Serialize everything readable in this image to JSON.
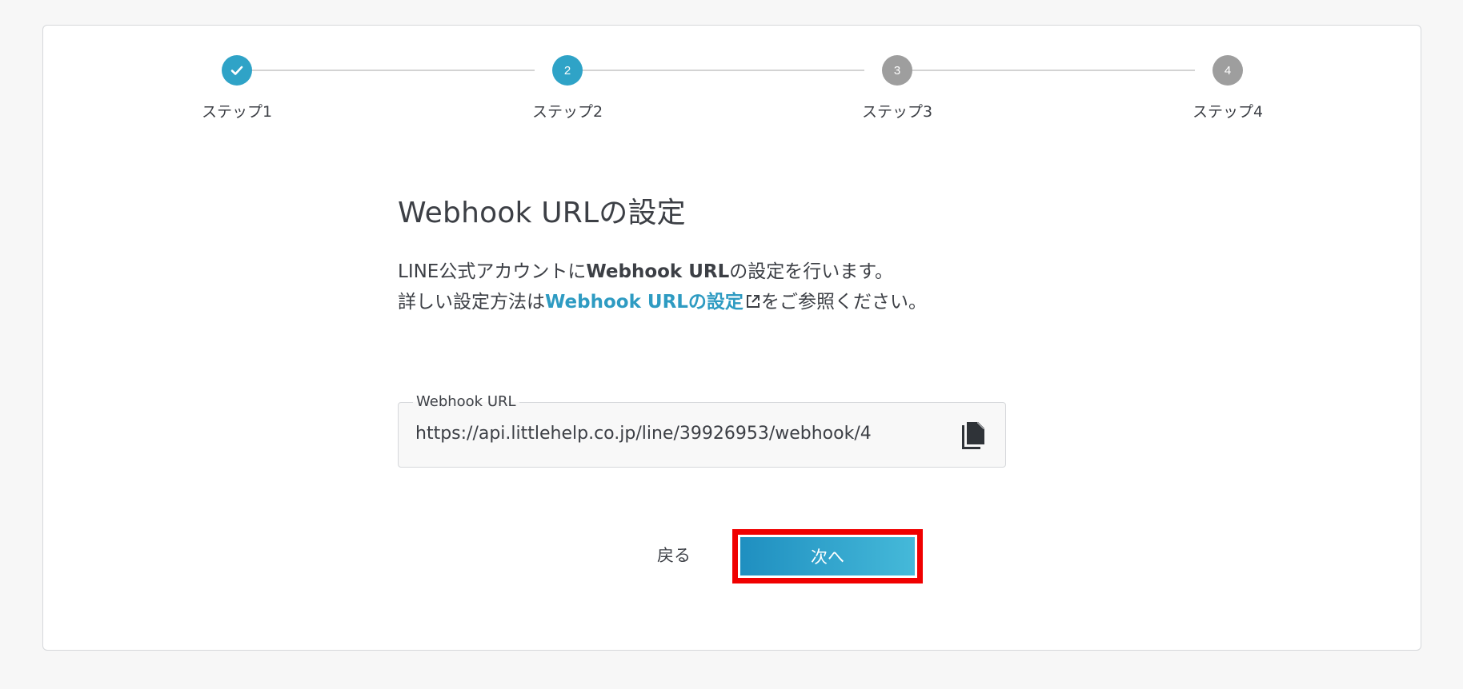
{
  "stepper": {
    "steps": [
      {
        "label": "ステップ1",
        "number": "",
        "state": "done"
      },
      {
        "label": "ステップ2",
        "number": "2",
        "state": "active"
      },
      {
        "label": "ステップ3",
        "number": "3",
        "state": "inactive"
      },
      {
        "label": "ステップ4",
        "number": "4",
        "state": "inactive"
      }
    ]
  },
  "main": {
    "title": "Webhook URLの設定",
    "desc_line1_prefix": "LINE公式アカウントに",
    "desc_line1_bold": "Webhook URL",
    "desc_line1_suffix": "の設定を行います。",
    "desc_line2_prefix": "詳しい設定方法は",
    "desc_line2_link": "Webhook URLの設定",
    "desc_line2_suffix": "をご参照ください。"
  },
  "webhook_field": {
    "legend": "Webhook URL",
    "value": "https://api.littlehelp.co.jp/line/39926953/webhook/4"
  },
  "actions": {
    "back_label": "戻る",
    "next_label": "次へ"
  },
  "colors": {
    "accent": "#2fa3c7",
    "inactive_step": "#9e9e9e",
    "highlight": "#f00000"
  }
}
